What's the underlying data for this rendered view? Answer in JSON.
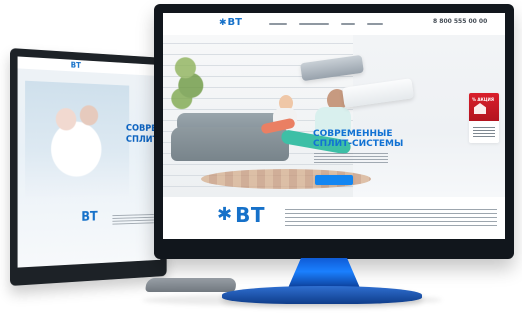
{
  "front_site": {
    "logo_text": "BT",
    "phone": "8 800 555 00 00",
    "hero_title": "СОВРЕМЕННЫЕ\nСПЛИТ-СИСТЕМЫ",
    "promo_badge": "% АКЦИЯ"
  },
  "back_site": {
    "logo_text": "BT",
    "headline": "СОВРЕ\nСПЛИТ"
  }
}
